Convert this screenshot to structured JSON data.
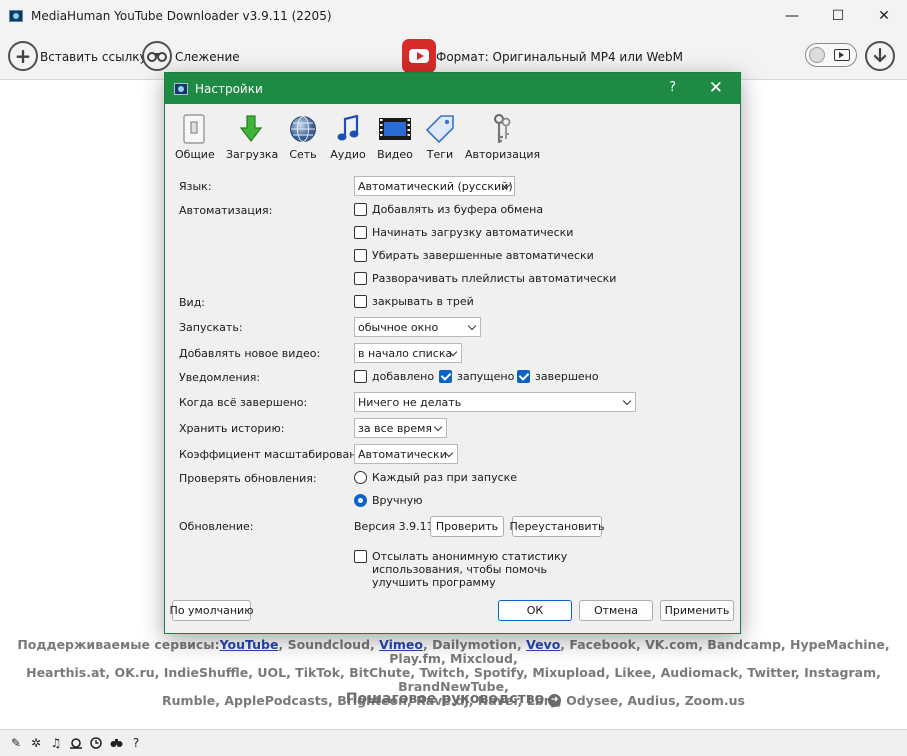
{
  "app": {
    "title": "MediaHuman YouTube Downloader v3.9.11 (2205)",
    "window_controls": {
      "minimize": "—",
      "maximize": "☐",
      "close": "✕"
    }
  },
  "toolbar": {
    "paste_label": "Вставить ссылку",
    "tracking_label": "Слежение",
    "format_label": "Формат: Оригинальный MP4 или WebM"
  },
  "dialog": {
    "title": "Настройки",
    "help": "?",
    "close": "✕",
    "categories": [
      {
        "label": "Общие",
        "icon": "switch-icon"
      },
      {
        "label": "Загрузка",
        "icon": "download-arrow-icon"
      },
      {
        "label": "Сеть",
        "icon": "globe-icon"
      },
      {
        "label": "Аудио",
        "icon": "music-note-icon"
      },
      {
        "label": "Видео",
        "icon": "film-icon"
      },
      {
        "label": "Теги",
        "icon": "tag-icon"
      },
      {
        "label": "Авторизация",
        "icon": "keys-icon"
      }
    ],
    "settings": {
      "language_label": "Язык:",
      "language_value": "Автоматический (русский)",
      "automation_label": "Автоматизация:",
      "automation_options": [
        {
          "label": "Добавлять из буфера обмена",
          "checked": false
        },
        {
          "label": "Начинать загрузку автоматически",
          "checked": false
        },
        {
          "label": "Убирать завершенные автоматически",
          "checked": false
        },
        {
          "label": "Разворачивать плейлисты автоматически",
          "checked": false
        }
      ],
      "view_label": "Вид:",
      "view_option": "закрывать в трей",
      "launch_label": "Запускать:",
      "launch_value": "обычное окно",
      "add_video_label": "Добавлять новое видео:",
      "add_video_value": "в начало списка",
      "notifications_label": "Уведомления:",
      "notifications": [
        {
          "label": "добавлено",
          "checked": false
        },
        {
          "label": "запущено",
          "checked": true
        },
        {
          "label": "завершено",
          "checked": true
        }
      ],
      "when_done_label": "Когда всё завершено:",
      "when_done_value": "Ничего не делать",
      "history_label": "Хранить историю:",
      "history_value": "за все время",
      "scale_label": "Коэффициент масштабирования:",
      "scale_value": "Автоматически",
      "check_updates_label": "Проверять обновления:",
      "check_updates_options": [
        {
          "label": "Каждый раз при запуске",
          "selected": false
        },
        {
          "label": "Вручную",
          "selected": true
        }
      ],
      "update_label": "Обновление:",
      "version_text": "Версия 3.9.11",
      "check_button": "Проверить",
      "reinstall_button": "Переустановить",
      "stats_lines": [
        "Отсылать анонимную статистику",
        "использования, чтобы помочь",
        "улучшить программу"
      ],
      "stats_checked": false
    },
    "buttons": {
      "defaults": "По умолчанию",
      "ok": "ОК",
      "cancel": "Отмена",
      "apply": "Применить"
    }
  },
  "services": {
    "prefix": "Поддерживаемые сервисы:",
    "line1_links": [
      "YouTube",
      "Vimeo",
      "Vevo"
    ],
    "line1": [
      {
        "text": "YouTube",
        "link": true
      },
      {
        "text": ", Soundcloud, ",
        "link": false
      },
      {
        "text": "Vimeo",
        "link": true
      },
      {
        "text": ", Dailymotion, ",
        "link": false
      },
      {
        "text": "Vevo",
        "link": true
      },
      {
        "text": ", Facebook, VK.com, Bandcamp, HypeMachine, Play.fm, Mixcloud,",
        "link": false
      }
    ],
    "line2": "Hearthis.at, OK.ru, IndieShuffle, UOL, TikTok, BitChute, Twitch, Spotify, Mixupload, Likee, Audiomack, Twitter, Instagram, BrandNewTube,",
    "line3": "Rumble, ApplePodcasts, Brighteon, Rave.dj, Naver, Lbry, Odysee, Audius, Zoom.us"
  },
  "guide": {
    "label": "Пошаговое руководство"
  },
  "statusbar": {
    "icons": [
      "brush-icon",
      "gear-icon",
      "music-note-icon",
      "snail-icon",
      "clock-icon",
      "binoculars-icon",
      "help-icon"
    ]
  },
  "colors": {
    "dialog_titlebar": "#1e8a44",
    "accent": "#0a64c8",
    "youtube_red": "#d82b2b",
    "link": "#2747b8"
  }
}
